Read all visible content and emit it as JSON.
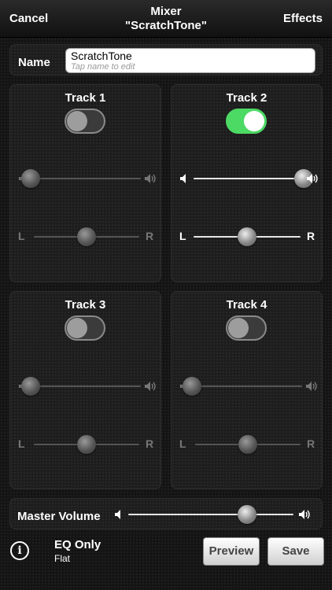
{
  "nav": {
    "cancel": "Cancel",
    "title_line1": "Mixer",
    "title_line2": "\"ScratchTone\"",
    "effects": "Effects"
  },
  "name_row": {
    "label": "Name",
    "value": "ScratchTone",
    "hint": "Tap name to edit"
  },
  "tracks": [
    {
      "title": "Track 1",
      "enabled": false,
      "volume": 0.0,
      "pan": 0.5,
      "left": "L",
      "right": "R"
    },
    {
      "title": "Track 2",
      "enabled": true,
      "volume": 1.0,
      "pan": 0.5,
      "left": "L",
      "right": "R"
    },
    {
      "title": "Track 3",
      "enabled": false,
      "volume": 0.0,
      "pan": 0.5,
      "left": "L",
      "right": "R"
    },
    {
      "title": "Track 4",
      "enabled": false,
      "volume": 0.0,
      "pan": 0.5,
      "left": "L",
      "right": "R"
    }
  ],
  "master": {
    "label": "Master Volume",
    "volume": 0.72
  },
  "footer": {
    "info_glyph": "i",
    "eq_title": "EQ Only",
    "eq_subtitle": "Flat",
    "preview": "Preview",
    "save": "Save"
  },
  "colors": {
    "toggle_on": "#4cd964"
  },
  "icons": [
    "speaker-low-icon",
    "speaker-high-icon",
    "info-icon"
  ]
}
